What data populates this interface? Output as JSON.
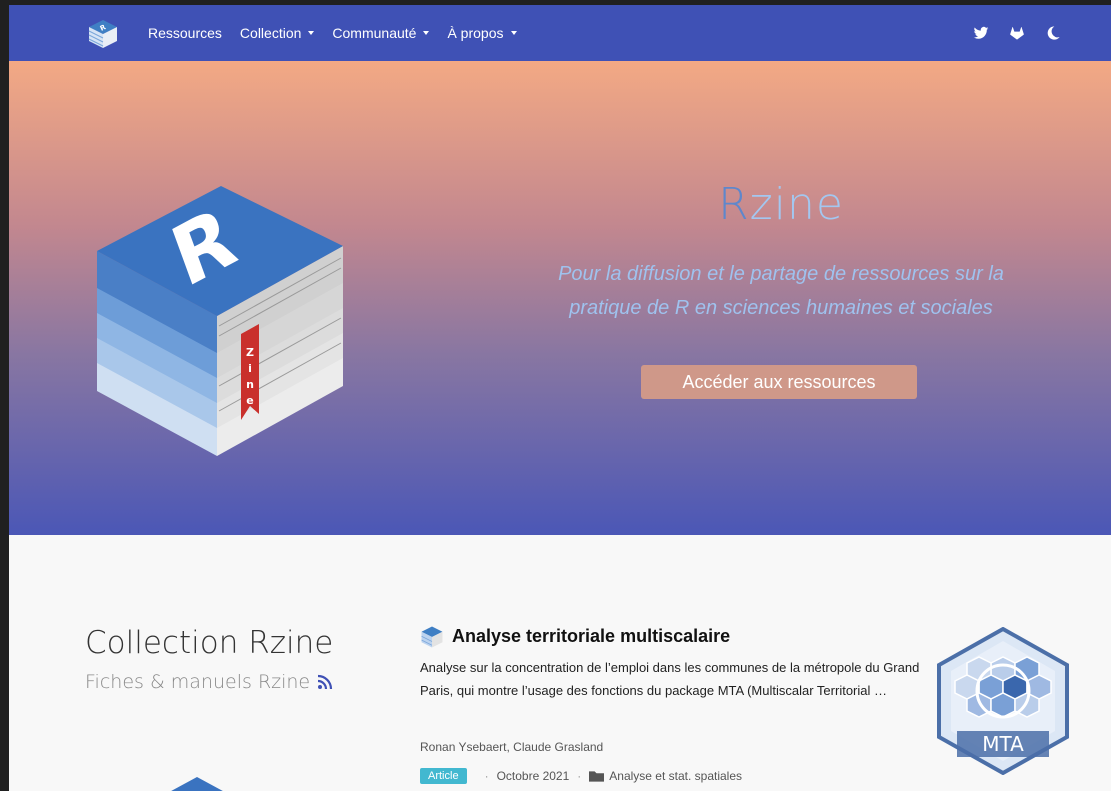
{
  "nav": {
    "links": [
      {
        "label": "Ressources",
        "dropdown": false
      },
      {
        "label": "Collection",
        "dropdown": true
      },
      {
        "label": "Communauté",
        "dropdown": true
      },
      {
        "label": "À propos",
        "dropdown": true
      }
    ],
    "icons": [
      "twitter-icon",
      "gitlab-icon",
      "moon-icon"
    ]
  },
  "hero": {
    "title_r": "R",
    "title_rest": "zine",
    "subtitle_line1": "Pour la diffusion et le partage de ressources sur la",
    "subtitle_line2": "pratique de R en sciences humaines et sociales",
    "button": "Accéder aux ressources"
  },
  "collection": {
    "title": "Collection Rzine",
    "subtitle": "Fiches & manuels Rzine"
  },
  "card": {
    "title": "Analyse territoriale multiscalaire",
    "summary": "Analyse sur la concentration de l’emploi dans les communes de la métropole du Grand Paris, qui montre l’usage des fonctions du package MTA (Multiscalar Territorial …",
    "authors": "Ronan Ysebaert, Claude Grasland",
    "badge": "Article",
    "date": "Octobre 2021",
    "category": "Analyse et stat. spatiales",
    "thumbnail_label": "MTA"
  },
  "colors": {
    "navbar": "#3f51b5",
    "accent_button": "#cf9889",
    "badge": "#42b8d0"
  }
}
